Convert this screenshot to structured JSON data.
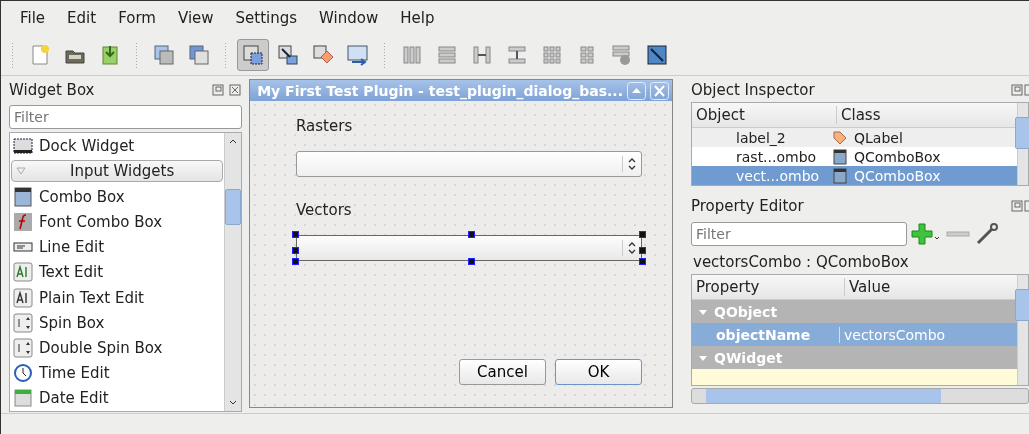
{
  "menu": [
    "File",
    "Edit",
    "Form",
    "View",
    "Settings",
    "Window",
    "Help"
  ],
  "toolbar": [
    [
      {
        "kind": "new",
        "selected": false
      },
      {
        "kind": "open",
        "selected": false
      },
      {
        "kind": "save",
        "selected": false
      }
    ],
    [
      {
        "kind": "back",
        "selected": false
      },
      {
        "kind": "front",
        "selected": false
      }
    ],
    [
      {
        "kind": "widgets",
        "selected": true
      },
      {
        "kind": "signals",
        "selected": false
      },
      {
        "kind": "buddies",
        "selected": false
      },
      {
        "kind": "taborder",
        "selected": false
      }
    ],
    [
      {
        "kind": "hlayout",
        "selected": false
      },
      {
        "kind": "vlayout",
        "selected": false
      },
      {
        "kind": "hsplit",
        "selected": false
      },
      {
        "kind": "vsplit",
        "selected": false
      },
      {
        "kind": "grid",
        "selected": false
      },
      {
        "kind": "form",
        "selected": false
      },
      {
        "kind": "break",
        "selected": false
      },
      {
        "kind": "adjust",
        "selected": false
      }
    ]
  ],
  "widget_box": {
    "title": "Widget Box",
    "filter_placeholder": "Filter",
    "items": [
      {
        "kind": "widget",
        "label": "Dock Widget"
      },
      {
        "kind": "category",
        "label": "Input Widgets"
      },
      {
        "kind": "widget",
        "label": "Combo Box"
      },
      {
        "kind": "widget",
        "label": "Font Combo Box"
      },
      {
        "kind": "widget",
        "label": "Line Edit"
      },
      {
        "kind": "widget",
        "label": "Text Edit"
      },
      {
        "kind": "widget",
        "label": "Plain Text Edit"
      },
      {
        "kind": "widget",
        "label": "Spin Box"
      },
      {
        "kind": "widget",
        "label": "Double Spin Box"
      },
      {
        "kind": "widget",
        "label": "Time Edit"
      },
      {
        "kind": "widget",
        "label": "Date Edit"
      }
    ]
  },
  "dialog": {
    "title": "My First Test Plugin - test_plugin_dialog_bas...",
    "fields": [
      {
        "label": "Rasters",
        "selected": false
      },
      {
        "label": "Vectors",
        "selected": true
      }
    ],
    "buttons": [
      {
        "label": "Cancel",
        "default": false
      },
      {
        "label": "OK",
        "default": true
      }
    ]
  },
  "object_inspector": {
    "title": "Object Inspector",
    "columns": [
      "Object",
      "Class"
    ],
    "rows": [
      {
        "object": "label_2",
        "class": "QLabel",
        "selected": false
      },
      {
        "object": "rast...ombo",
        "class": "QComboBox",
        "selected": false
      },
      {
        "object": "vect...ombo",
        "class": "QComboBox",
        "selected": true
      }
    ]
  },
  "property_editor": {
    "title": "Property Editor",
    "filter_placeholder": "Filter",
    "object_label": "vectorsCombo : QComboBox",
    "columns": [
      "Property",
      "Value"
    ],
    "rows": [
      {
        "kind": "group",
        "name": "QObject"
      },
      {
        "kind": "property",
        "name": "objectName",
        "value": "vectorsCombo",
        "selected": true
      },
      {
        "kind": "group",
        "name": "QWidget"
      }
    ]
  }
}
